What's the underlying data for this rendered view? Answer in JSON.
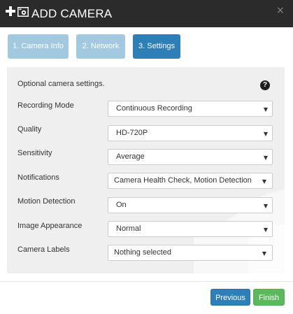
{
  "header": {
    "title": "ADD CAMERA",
    "close_glyph": "×",
    "icons": [
      "plus-icon",
      "camera-icon",
      "close-icon"
    ]
  },
  "steps": [
    {
      "label": "1. Camera Info",
      "state": "done"
    },
    {
      "label": "2. Network",
      "state": "done"
    },
    {
      "label": "3. Settings",
      "state": "active"
    }
  ],
  "settings": {
    "intro": "Optional camera settings.",
    "help_glyph": "?",
    "caret": "▼",
    "rows": [
      {
        "label": "Recording Mode",
        "value": "Continuous Recording"
      },
      {
        "label": "Quality",
        "value": "HD-720P"
      },
      {
        "label": "Sensitivity",
        "value": "Average"
      },
      {
        "label": "Notifications",
        "value": "Camera Health Check, Motion Detection"
      },
      {
        "label": "Motion Detection",
        "value": "On"
      },
      {
        "label": "Image Appearance",
        "value": "Normal"
      },
      {
        "label": "Camera Labels",
        "value": "Nothing selected"
      }
    ]
  },
  "footer": {
    "previous_label": "Previous",
    "finish_label": "Finish"
  },
  "colors": {
    "header_bg": "#2b2b2b",
    "step_done": "#a3c9e0",
    "step_active": "#2e7eb7",
    "panel_bg": "#efefef",
    "primary": "#2e7eb7",
    "success": "#5cb85c"
  }
}
